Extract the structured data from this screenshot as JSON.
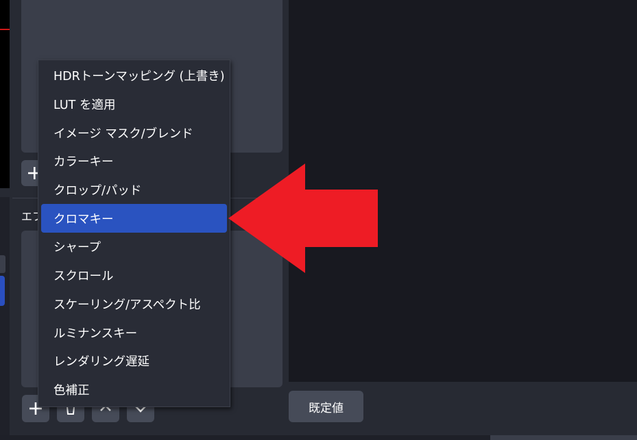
{
  "panel": {
    "effects_label": "エフ",
    "default_button": "既定値"
  },
  "toolbar": {
    "add": "plus-icon",
    "remove": "trash-icon",
    "up": "chevron-up-icon",
    "down": "chevron-down-icon"
  },
  "menu": {
    "items": [
      "HDRトーンマッピング (上書き)",
      "LUT を適用",
      "イメージ マスク/ブレンド",
      "カラーキー",
      "クロップ/パッド",
      "クロマキー",
      "シャープ",
      "スクロール",
      "スケーリング/アスペクト比",
      "ルミナンスキー",
      "レンダリング遅延",
      "色補正"
    ],
    "selected_index": 5
  },
  "colors": {
    "selection": "#2a53c0",
    "arrow": "#ee1c25",
    "background": "#272a33"
  }
}
